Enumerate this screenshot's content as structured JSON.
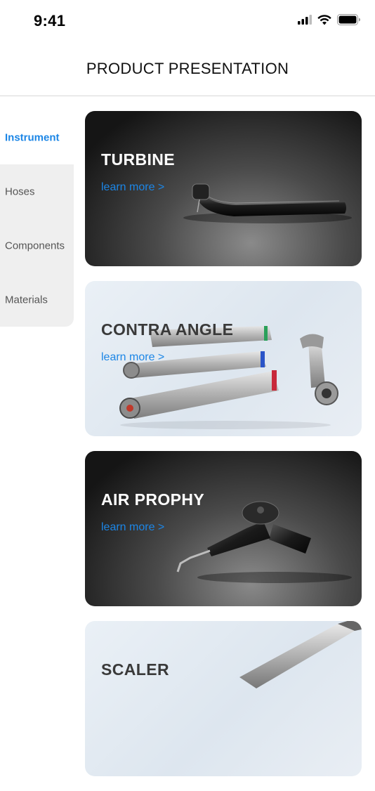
{
  "status_bar": {
    "time": "9:41"
  },
  "header": {
    "title": "PRODUCT PRESENTATION"
  },
  "sidebar": {
    "items": [
      {
        "label": "Instrument",
        "active": true
      },
      {
        "label": "Hoses",
        "active": false
      },
      {
        "label": "Components",
        "active": false
      },
      {
        "label": "Materials",
        "active": false
      }
    ]
  },
  "cards": [
    {
      "title": "TURBINE",
      "link": "learn more >",
      "icon": "turbine-handpiece-photo"
    },
    {
      "title": "CONTRA ANGLE",
      "link": "learn more >",
      "icon": "contra-angle-handpieces-photo"
    },
    {
      "title": "AIR PROPHY",
      "link": "learn more >",
      "icon": "air-prophy-handpiece-photo"
    },
    {
      "title": "SCALER",
      "link": "",
      "icon": "scaler-handpiece-photo"
    }
  ],
  "colors": {
    "accent": "#1c86e6",
    "sidebar_bg": "#efefef",
    "divider": "#d7d7d7"
  }
}
